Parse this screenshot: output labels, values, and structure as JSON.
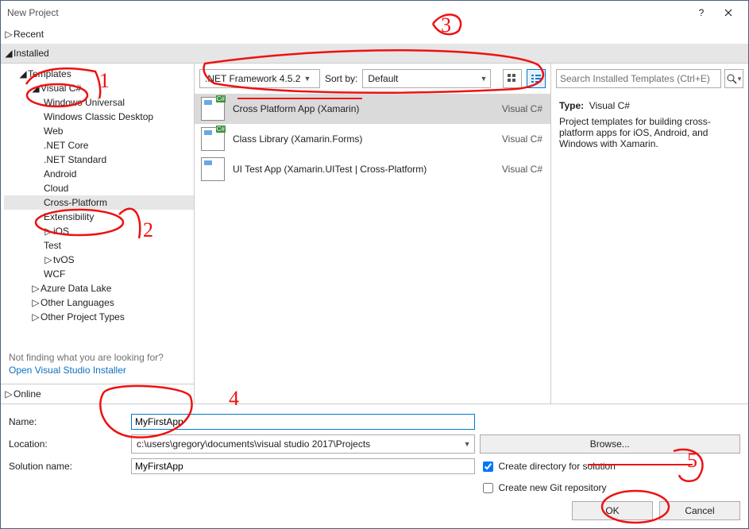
{
  "window": {
    "title": "New Project"
  },
  "treeHeaders": {
    "recent": "Recent",
    "installed": "Installed",
    "online": "Online"
  },
  "tree": {
    "templates": "Templates",
    "vcs": "Visual C#",
    "children": [
      "Windows Universal",
      "Windows Classic Desktop",
      "Web",
      ".NET Core",
      ".NET Standard",
      "Android",
      "Cloud",
      "Cross-Platform",
      "Extensibility",
      "iOS",
      "Test",
      "tvOS",
      "WCF"
    ],
    "siblings": [
      "Azure Data Lake",
      "Other Languages",
      "Other Project Types"
    ]
  },
  "notFinding": "Not finding what you are looking for?",
  "openInstaller": "Open Visual Studio Installer",
  "filter": {
    "framework": ".NET Framework 4.5.2",
    "sortLabel": "Sort by:",
    "sortValue": "Default"
  },
  "templates": [
    {
      "name": "Cross Platform App (Xamarin)",
      "lang": "Visual C#",
      "selected": true
    },
    {
      "name": "Class Library (Xamarin.Forms)",
      "lang": "Visual C#",
      "selected": false
    },
    {
      "name": "UI Test App (Xamarin.UITest | Cross-Platform)",
      "lang": "Visual C#",
      "selected": false
    }
  ],
  "search": {
    "placeholder": "Search Installed Templates (Ctrl+E)"
  },
  "info": {
    "typeLabel": "Type:",
    "typeValue": "Visual C#",
    "desc": "Project templates for building cross-platform apps for iOS, Android, and Windows with Xamarin."
  },
  "form": {
    "nameLabel": "Name:",
    "nameValue": "MyFirstApp",
    "locationLabel": "Location:",
    "locationValue": "c:\\users\\gregory\\documents\\visual studio 2017\\Projects",
    "browse": "Browse...",
    "solutionLabel": "Solution name:",
    "solutionValue": "MyFirstApp",
    "createDir": "Create directory for solution",
    "createGit": "Create new Git repository",
    "ok": "OK",
    "cancel": "Cancel"
  },
  "annotations": [
    "1",
    "2",
    "3",
    "4",
    "5"
  ]
}
